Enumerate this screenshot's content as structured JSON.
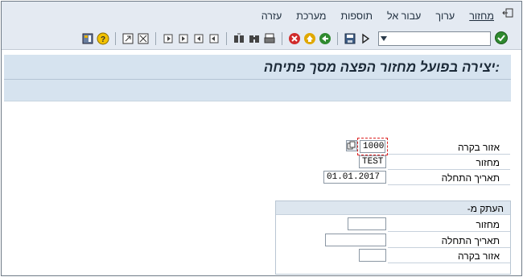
{
  "menubar": {
    "exit_icon": "exit-icon",
    "items": [
      {
        "label": "מחזור"
      },
      {
        "label": "ערוך"
      },
      {
        "label": "עבור אל"
      },
      {
        "label": "תוספות"
      },
      {
        "label": "מערכת"
      },
      {
        "label": "עזרה"
      }
    ]
  },
  "toolbar": {
    "command_field_value": "",
    "icons": [
      "enter-icon",
      "command-dropdown",
      "play-icon",
      "save-icon",
      "back-icon",
      "exit-icon",
      "cancel-icon",
      "print-icon",
      "find-icon",
      "find-next-icon",
      "first-page-icon",
      "prev-page-icon",
      "next-page-icon",
      "last-page-icon",
      "create-session-icon",
      "shortcut-icon",
      "help-icon",
      "customize-layout-icon"
    ]
  },
  "title": ":יצירה בפועל מחזור הפצה מסך פתיחה",
  "form": {
    "area": {
      "label": "אזור בקרה",
      "value": "1000"
    },
    "cycle": {
      "label": "מחזור",
      "value": "TEST"
    },
    "start_date": {
      "label": "תאריך התחלה",
      "value": "01.01.2017"
    }
  },
  "copy_from": {
    "header": "העתק מ-",
    "cycle": {
      "label": "מחזור",
      "value": ""
    },
    "start_date": {
      "label": "תאריך התחלה",
      "value": ""
    },
    "area": {
      "label": "אזור בקרה",
      "value": ""
    }
  }
}
